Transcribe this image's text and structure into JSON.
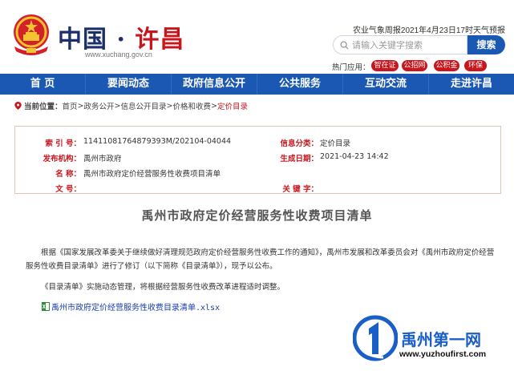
{
  "header": {
    "site_name_main": "中国 · ",
    "site_name_accent": "许昌",
    "site_url": "www.xuchang.gov.cn",
    "weather": "农业气象周报2021年4月23日17时天气预报",
    "search_placeholder": "请输入关键字搜索",
    "search_button": "搜索",
    "hot_label": "热门应用：",
    "hot_tags": [
      "智在证",
      "公招网",
      "公积金",
      "环保"
    ]
  },
  "nav": {
    "items": [
      "首 页",
      "要闻动态",
      "政府信息公开",
      "公共服务",
      "互动交流",
      "走进许昌"
    ]
  },
  "breadcrumb": {
    "label": "当前位置：",
    "items": [
      "首页",
      "政务公开",
      "信息公开目录",
      "价格和收费",
      "定价目录"
    ],
    "separator": " > "
  },
  "meta": {
    "index_key": "索 引 号：",
    "index_val": "11411081764879393M/202104-04044",
    "category_key": "信息分类：",
    "category_val": "定价目录",
    "publisher_key": "发布机构：",
    "publisher_val": "禹州市政府",
    "date_key": "生成日期：",
    "date_val": "2021-04-23 14:42",
    "name_key": "名 称：",
    "name_val": "禹州市政府定价经营服务性收费项目清单",
    "docno_key": "文 号：",
    "docno_val": "",
    "keyword_key": "关 键 字：",
    "keyword_val": ""
  },
  "article": {
    "title": "禹州市政府定价经营服务性收费项目清单",
    "para1": "根据《国家发展改革委关于继续做好清理规范政府定价经营服务性收费工作的通知》，禹州市发展和改革委员会对《禹州市政府定价经营服务性收费目录清单》进行了修订（以下简称《目录清单》），现予以公布。",
    "para2": "《目录清单》实施动态管理，将根据经营服务性收费改革进程适时调整。",
    "attachment": "禹州市政府定价经营服务性收费目录清单.xlsx"
  },
  "watermark": {
    "name": "禹州第一网",
    "url": "www.yuzhoufirst.com"
  },
  "colors": {
    "brand_blue": "#1a58b4",
    "accent_red": "#c8161d"
  }
}
